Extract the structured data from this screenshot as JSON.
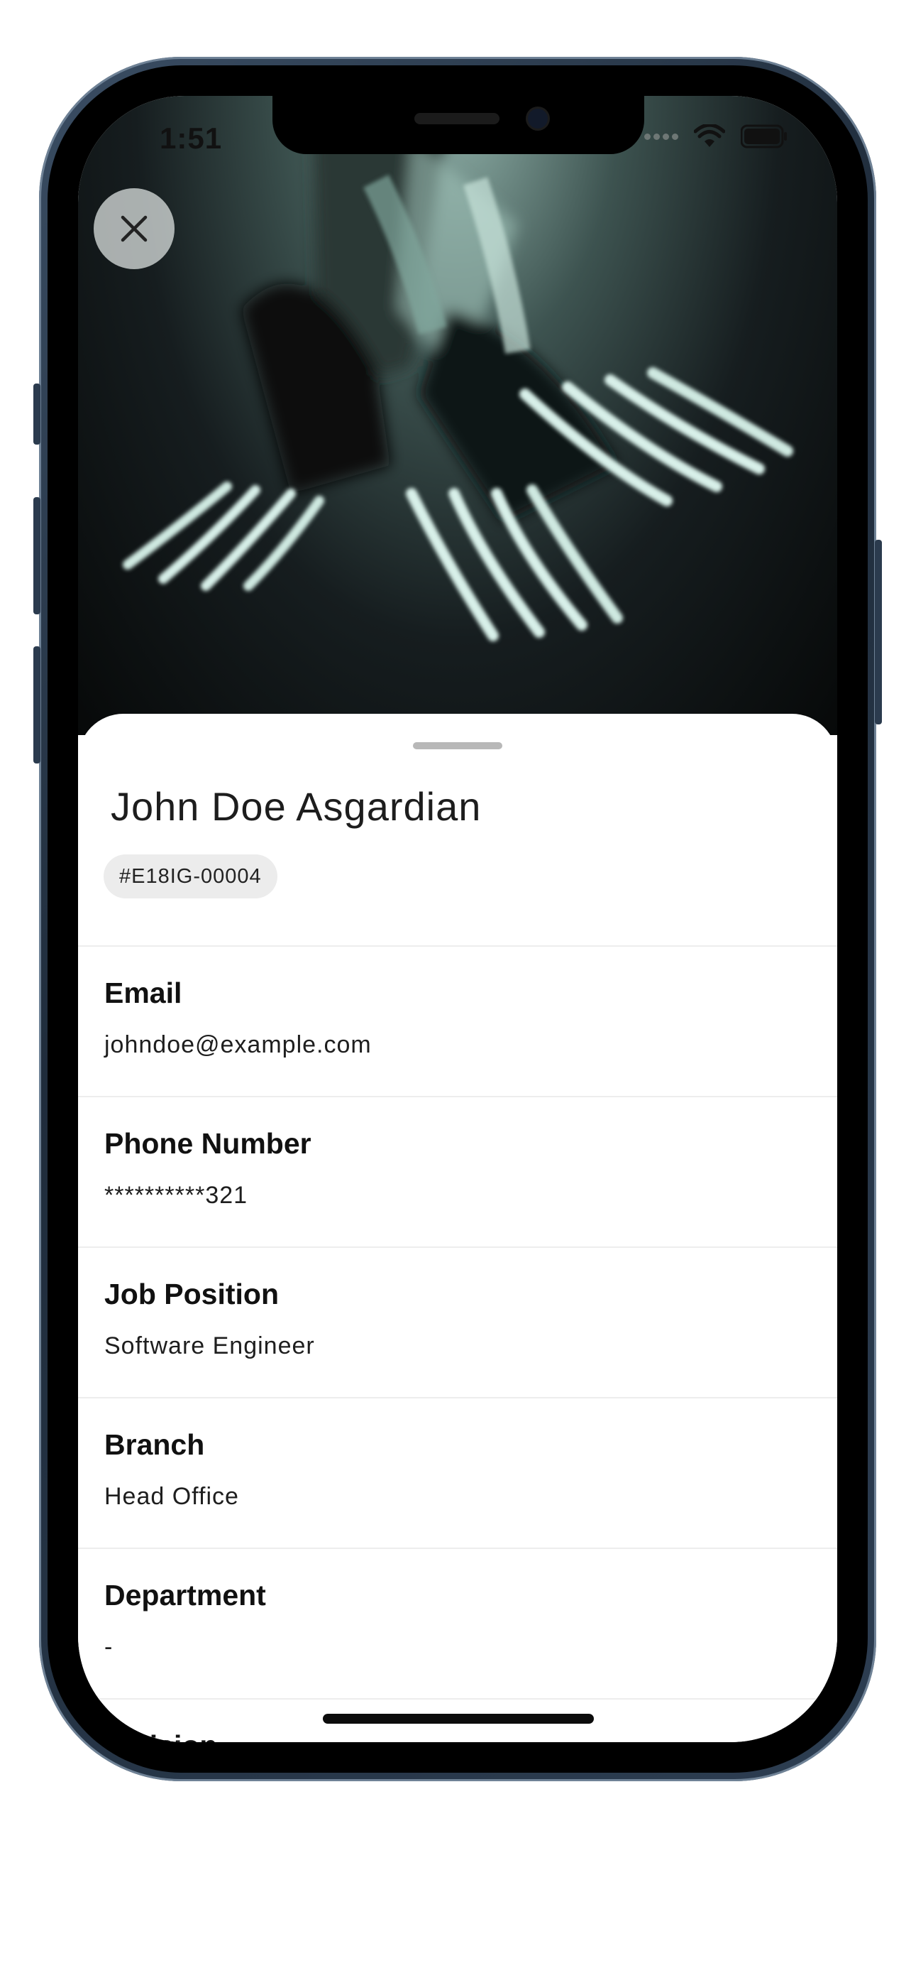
{
  "status_bar": {
    "time": "1:51"
  },
  "hero": {
    "close_icon": "close-icon"
  },
  "profile": {
    "name": "John Doe Asgardian",
    "id_badge": "#E18IG-00004"
  },
  "fields": [
    {
      "label": "Email",
      "value": "johndoe@example.com"
    },
    {
      "label": "Phone Number",
      "value": "**********321"
    },
    {
      "label": "Job Position",
      "value": "Software Engineer"
    },
    {
      "label": "Branch",
      "value": "Head Office"
    },
    {
      "label": "Department",
      "value": "-"
    },
    {
      "label": "Division",
      "value": ""
    }
  ],
  "colors": {
    "sheet": "#ffffff",
    "chip": "#ececec",
    "divider": "#ededed"
  }
}
